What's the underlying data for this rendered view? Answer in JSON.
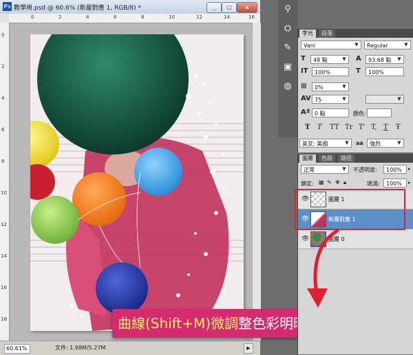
{
  "document": {
    "title": "教學用.psd @ 60.6% (新層對應 1, RGB/8) *",
    "buttons": {
      "minimize": "_",
      "maximize": "□",
      "close": "x"
    },
    "ruler_top_labels": [
      "0",
      "2",
      "4",
      "6",
      "8",
      "10",
      "12",
      "14",
      "16"
    ],
    "ruler_left_labels": [
      "0",
      "2",
      "4",
      "6",
      "8",
      "10",
      "12",
      "14",
      "16",
      "18"
    ],
    "status": {
      "zoom": "60.61%",
      "doc_info": "文件: 1.98M/5.27M"
    }
  },
  "callout": {
    "highlight": "曲線(Shift+M)微調",
    "rest": "整色彩明暗"
  },
  "character_panel": {
    "tabs": [
      "字元",
      "段落"
    ],
    "font_family": "Vani",
    "font_style": "Regular",
    "font_size": "48 點",
    "leading": "93.68 點",
    "vertical_scale": "100%",
    "horizontal_scale": "100%",
    "tsume": "0%",
    "tracking": "75",
    "baseline_shift": "0 點",
    "color_label": "顏色:",
    "style_buttons": [
      "T",
      "T",
      "TT",
      "Tr",
      "T'",
      "T,",
      "T",
      "Ŧ"
    ],
    "language": "英文: 美國",
    "aa_label": "aa",
    "anti_alias": "強烈"
  },
  "layers_panel": {
    "tabs": [
      "圖層",
      "色版",
      "路徑"
    ],
    "blend_mode": "正常",
    "opacity_label": "不透明度:",
    "opacity": "100%",
    "lock_label": "鎖定:",
    "fill_label": "填滿:",
    "fill": "100%",
    "layers": [
      {
        "name": "圖層 1",
        "selected": false
      },
      {
        "name": "新層對應 1",
        "selected": true
      },
      {
        "name": "圖層 0",
        "selected": false
      }
    ]
  },
  "colors": {
    "accent_pink": "#d62a6f",
    "highlight_yellow": "#fff36b",
    "selection_blue": "#5d90c9",
    "annotation_red": "#e02030"
  }
}
